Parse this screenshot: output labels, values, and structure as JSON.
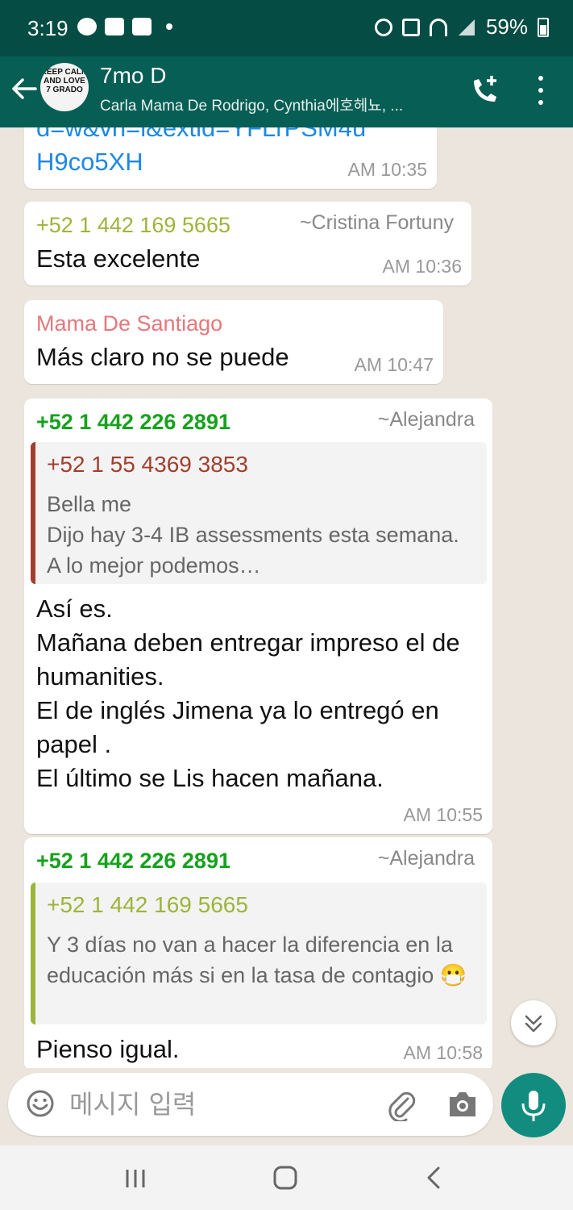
{
  "status_bar": {
    "time": "3:19",
    "battery": "59%"
  },
  "header": {
    "avatar_text": "KEEP CALM AND LOVE 7 GRADO",
    "title": "7mo D",
    "subtitle": "Carla Mama De Rodrigo, Cynthia에호헤뇨, ..."
  },
  "messages": [
    {
      "link_text": "d=w&vh=l&extid=YFLrPSM4u\nH9co5XH",
      "time": "AM 10:35"
    },
    {
      "sender": "+52 1 442 169 5665",
      "sender_color": "#9bb53a",
      "alias": "~Cristina Fortuny",
      "text": "Esta excelente",
      "time": "AM 10:36"
    },
    {
      "sender": "Mama De Santiago",
      "sender_color": "#e7777c",
      "text": "Más claro no se puede",
      "time": "AM 10:47"
    },
    {
      "sender": "+52 1 442 226 2891",
      "sender_color": "#15a21d",
      "alias": "~Alejandra",
      "quote": {
        "name": "+52 1 55 4369 3853",
        "name_color": "#a13f2e",
        "text": "Bella me\nDijo hay 3-4 IB assessments esta semana. A lo mejor podemos…"
      },
      "text": "Así es.\nMañana deben entregar impreso el de humanities.\nEl de inglés Jimena ya lo entregó en papel .\nEl último se Lis hacen mañana.",
      "time": "AM 10:55"
    },
    {
      "sender": "+52 1 442 226 2891",
      "sender_color": "#15a21d",
      "alias": "~Alejandra",
      "quote": {
        "name": "+52 1 442 169 5665",
        "name_color": "#9bb53a",
        "text": "Y 3 días no van a hacer la diferencia en la educación más si en la tasa de contagio 😷"
      },
      "text": "Pienso igual.",
      "time": "AM 10:58"
    }
  ],
  "composer": {
    "placeholder": "메시지 입력"
  },
  "colors": {
    "header": "#075e54",
    "statusbar": "#054d44",
    "chat_background": "#ece5dd",
    "mic_button": "#128c7e",
    "link": "#1e88e5"
  },
  "icons": {
    "back": "arrow-left-icon",
    "call": "add-call-icon",
    "menu": "more-vertical-icon",
    "emoji": "smiley-icon",
    "attach": "paperclip-icon",
    "camera": "camera-icon",
    "mic": "microphone-icon",
    "scroll": "chevrons-down-icon"
  }
}
